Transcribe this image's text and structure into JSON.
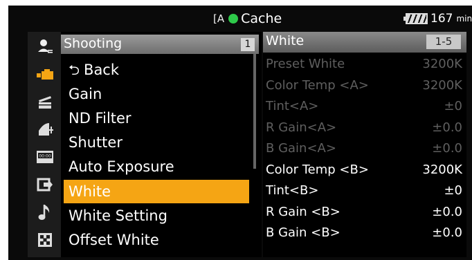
{
  "status": {
    "media_label": "Cache",
    "battery_minutes": "167",
    "battery_unit": "min"
  },
  "menu": {
    "title": "Shooting",
    "page": "1",
    "items": [
      {
        "label": "Back",
        "has_back_icon": true
      },
      {
        "label": "Gain"
      },
      {
        "label": "ND Filter"
      },
      {
        "label": "Shutter"
      },
      {
        "label": "Auto Exposure"
      },
      {
        "label": "White",
        "selected": true
      },
      {
        "label": "White Setting"
      },
      {
        "label": "Offset White"
      }
    ],
    "category_icons": [
      "user-icon",
      "camera-icon",
      "clapper-icon",
      "paint-icon",
      "timecode-icon",
      "output-icon",
      "audio-icon",
      "maintenance-icon"
    ],
    "selected_category": "camera-icon"
  },
  "panel": {
    "title": "White",
    "range": "1-5",
    "rows": [
      {
        "label": "Preset White",
        "value": "3200K",
        "enabled": false
      },
      {
        "label": "Color Temp <A>",
        "value": "3200K",
        "enabled": false
      },
      {
        "label": "Tint<A>",
        "value": "±0",
        "enabled": false
      },
      {
        "label": "R Gain<A>",
        "value": "±0.0",
        "enabled": false
      },
      {
        "label": "B Gain<A>",
        "value": "±0.0",
        "enabled": false
      },
      {
        "label": "Color Temp <B>",
        "value": "3200K",
        "enabled": true
      },
      {
        "label": "Tint<B>",
        "value": "±0",
        "enabled": true
      },
      {
        "label": "R Gain <B>",
        "value": "±0.0",
        "enabled": true
      },
      {
        "label": "B Gain <B>",
        "value": "±0.0",
        "enabled": true
      }
    ]
  },
  "colors": {
    "selection": "#f5a514",
    "recording_dot": "#2ec94a",
    "disabled_text": "#5f5f5f"
  }
}
